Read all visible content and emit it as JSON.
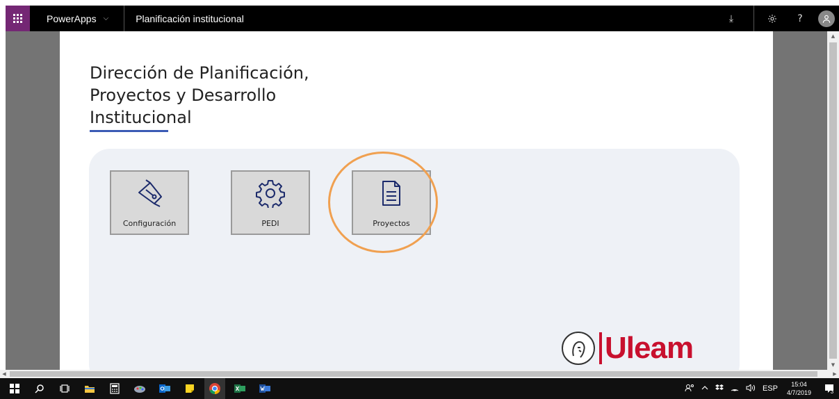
{
  "header": {
    "app_name": "PowerApps",
    "app_chevron": "⌵",
    "title": "Planificación institucional",
    "download_glyph": "⤓",
    "help_glyph": "?",
    "colors": {
      "waffle_bg": "#742774",
      "bar_bg": "#000000"
    }
  },
  "canvas": {
    "heading_line1": "Dirección de Planificación,",
    "heading_line2": "Proyectos y Desarrollo",
    "heading_line3": "Institucional",
    "accent_color": "#3b5bb5",
    "tiles": [
      {
        "label": "Configuración",
        "icon": "pen-nib-icon"
      },
      {
        "label": "PEDI",
        "icon": "gear-icon"
      },
      {
        "label": "Proyectos",
        "icon": "document-icon"
      }
    ],
    "highlight_color": "#f0a050",
    "logo_text": "Uleam",
    "logo_color": "#c8102e"
  },
  "taskbar": {
    "tray_language": "ESP",
    "time": "15:04",
    "date": "4/7/2019",
    "notification_count": "3"
  }
}
